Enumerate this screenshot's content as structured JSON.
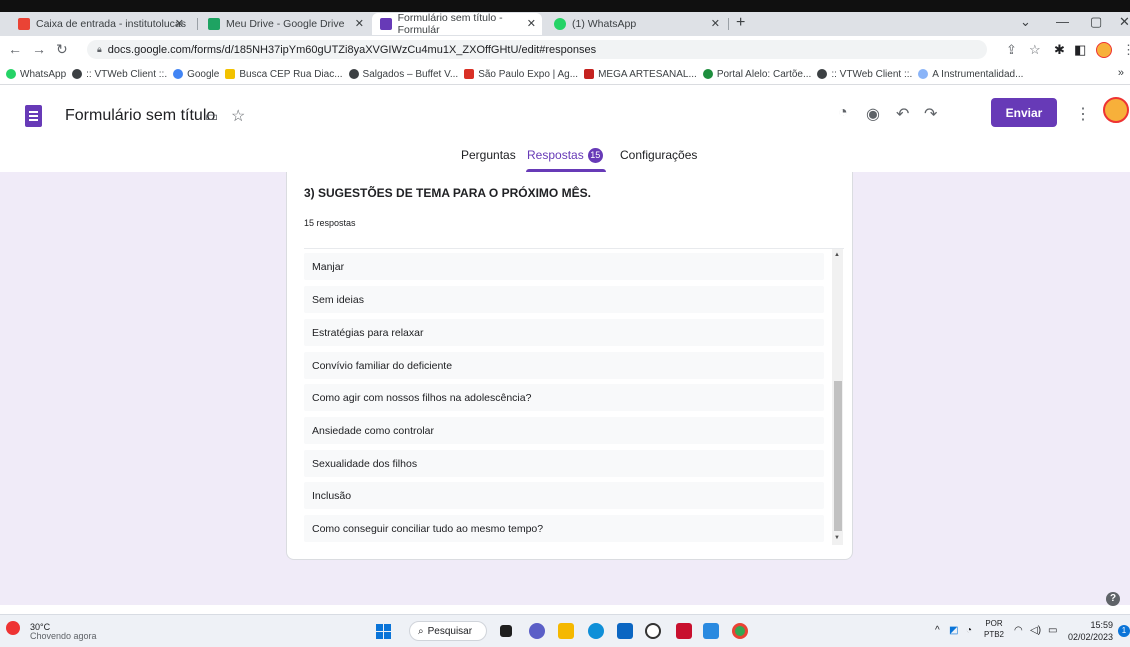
{
  "browser": {
    "tabs": [
      {
        "title": "Caixa de entrada - institutolucas",
        "color": "#ea4335"
      },
      {
        "title": "Meu Drive - Google Drive",
        "color": "#1ea362"
      },
      {
        "title": "Formulário sem título - Formulár",
        "color": "#673ab7"
      },
      {
        "title": "(1) WhatsApp",
        "color": "#25d366"
      }
    ],
    "url": "docs.google.com/forms/d/185NH37ipYm60gUTZi8yaXVGIWzCu4mu1X_ZXOffGHtU/edit#responses",
    "bookmarks": [
      {
        "label": "WhatsApp",
        "color": "#25d366"
      },
      {
        "label": ":: VTWeb Client ::.",
        "color": "#3c4043"
      },
      {
        "label": "Google",
        "color": "#4285f4"
      },
      {
        "label": "Busca CEP Rua Diac...",
        "color": "#f2c200"
      },
      {
        "label": "Salgados – Buffet V...",
        "color": "#3c4043"
      },
      {
        "label": "São Paulo Expo | Ag...",
        "color": "#d93025"
      },
      {
        "label": "MEGA ARTESANAL...",
        "color": "#c5221f"
      },
      {
        "label": "Portal Alelo: Cartõe...",
        "color": "#1e8e3e"
      },
      {
        "label": ":: VTWeb Client ::.",
        "color": "#3c4043"
      },
      {
        "label": "A Instrumentalidad...",
        "color": "#8ab4f8"
      }
    ],
    "more_bookmarks": "»"
  },
  "form": {
    "title": "Formulário sem título",
    "send_label": "Enviar",
    "tabs": {
      "questions": "Perguntas",
      "responses": "Respostas",
      "responses_count": "15",
      "settings": "Configurações"
    }
  },
  "question": {
    "title": "3) SUGESTÕES DE TEMA PARA O PRÓXIMO MÊS.",
    "response_count": "15 respostas",
    "responses": [
      "Manjar",
      "Sem ideias",
      "Estratégias para relaxar",
      "Convívio familiar do deficiente",
      "Como agir com nossos filhos na adolescência?",
      "Ansiedade como controlar",
      "Sexualidade dos filhos",
      "Inclusão",
      "Como conseguir conciliar tudo ao mesmo tempo?"
    ]
  },
  "taskbar": {
    "weather_temp": "30°C",
    "weather_desc": "Chovendo agora",
    "search_label": "Pesquisar",
    "language": "POR",
    "keyboard": "PTB2",
    "time": "15:59",
    "date": "02/02/2023",
    "notification_count": "1"
  }
}
